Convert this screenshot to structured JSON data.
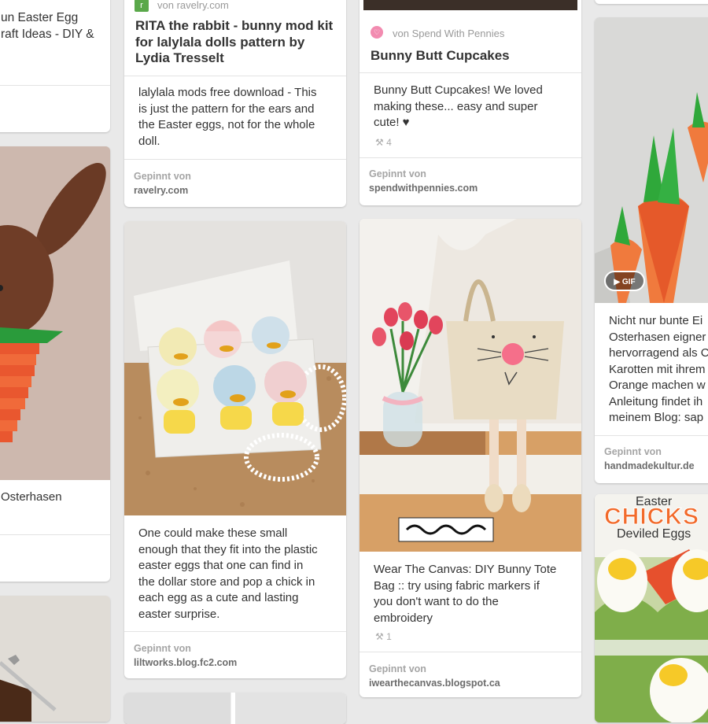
{
  "cards": {
    "c1": {
      "title_l1": "un Easter Egg",
      "title_l2": "raft Ideas - DIY &"
    },
    "c2": {
      "caption": "Osterhasen"
    },
    "rita": {
      "via_badge": "r",
      "via": "von ravelry.com",
      "title": [
        "RITA the rabbit - bunny mod kit",
        "for lalylala dolls pattern by",
        "Lydia Tresselt"
      ],
      "description": [
        "lalylala mods free download - This",
        "is just the pattern for the ears and",
        "the Easter eggs, not for the whole",
        "doll."
      ],
      "pinned_label": "Gepinnt von",
      "pinned_source": "ravelry.com"
    },
    "chicks": {
      "description": [
        "One could make these small",
        "enough that they fit into the plastic",
        "easter eggs that one can find in",
        "the dollar store and pop a chick in",
        "each egg as a cute and lasting",
        "easter surprise."
      ],
      "pinned_label": "Gepinnt von",
      "pinned_source": "liltworks.blog.fc2.com"
    },
    "cupcakes": {
      "via": "von Spend With Pennies",
      "title": "Bunny Butt Cupcakes",
      "description": [
        "Bunny Butt Cupcakes! We loved",
        "making these... easy and super",
        "cute! ♥"
      ],
      "repins": "4",
      "pinned_label": "Gepinnt von",
      "pinned_source": "spendwithpennies.com"
    },
    "tote": {
      "description": [
        "Wear The Canvas: DIY Bunny Tote",
        "Bag :: try using fabric markers if",
        "you don't want to do the",
        "embroidery"
      ],
      "repins": "1",
      "pinned_label": "Gepinnt von",
      "pinned_source": "iwearthecanvas.blogspot.ca"
    },
    "carrots": {
      "gif_badge": "GIF",
      "description": [
        "Nicht nur bunte Ei",
        "Osterhasen eigner",
        "hervorragend als C",
        "Karotten mit ihrem",
        "Orange machen w",
        "Anleitung findet ih",
        "meinem Blog: sap"
      ],
      "pinned_label": "Gepinnt von",
      "pinned_source": "handmadekultur.de"
    },
    "eggs": {
      "image_text_l1": "Easter",
      "image_text_l2": "CHICKS",
      "image_text_l3": "Deviled Eggs"
    }
  },
  "icons": {
    "repin": "pin-icon",
    "play": "play-icon",
    "source": "spend-with-pennies-icon"
  },
  "colors": {
    "background": "#e9e9e9",
    "card": "#ffffff",
    "carrot": "#f26a2a",
    "leaf": "#2fa83a",
    "chick_yellow": "#f6c928"
  }
}
